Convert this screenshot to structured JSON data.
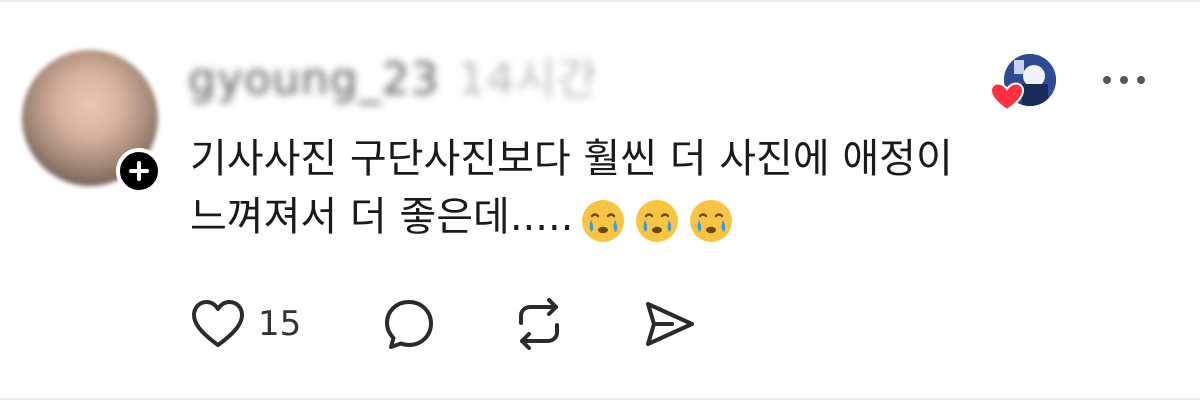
{
  "post": {
    "username": "gyoung_23",
    "time": "14시간",
    "comment_lines": [
      "기사사진 구단사진보다 훨씬 더 사진에 애정이",
      "느껴져서 더 좋은데....."
    ],
    "emojis": [
      "face-holding-back-tears",
      "face-holding-back-tears",
      "face-holding-back-tears"
    ]
  },
  "actions": {
    "like_count": "15",
    "icons": [
      "heart-outline-icon",
      "comment-bubble-icon",
      "repost-icon",
      "share-send-icon"
    ]
  },
  "colors": {
    "text": "#1a1a1a",
    "heart_red": "#ff3040",
    "icon": "#2b2b2b",
    "divider": "#e9e9e9"
  }
}
